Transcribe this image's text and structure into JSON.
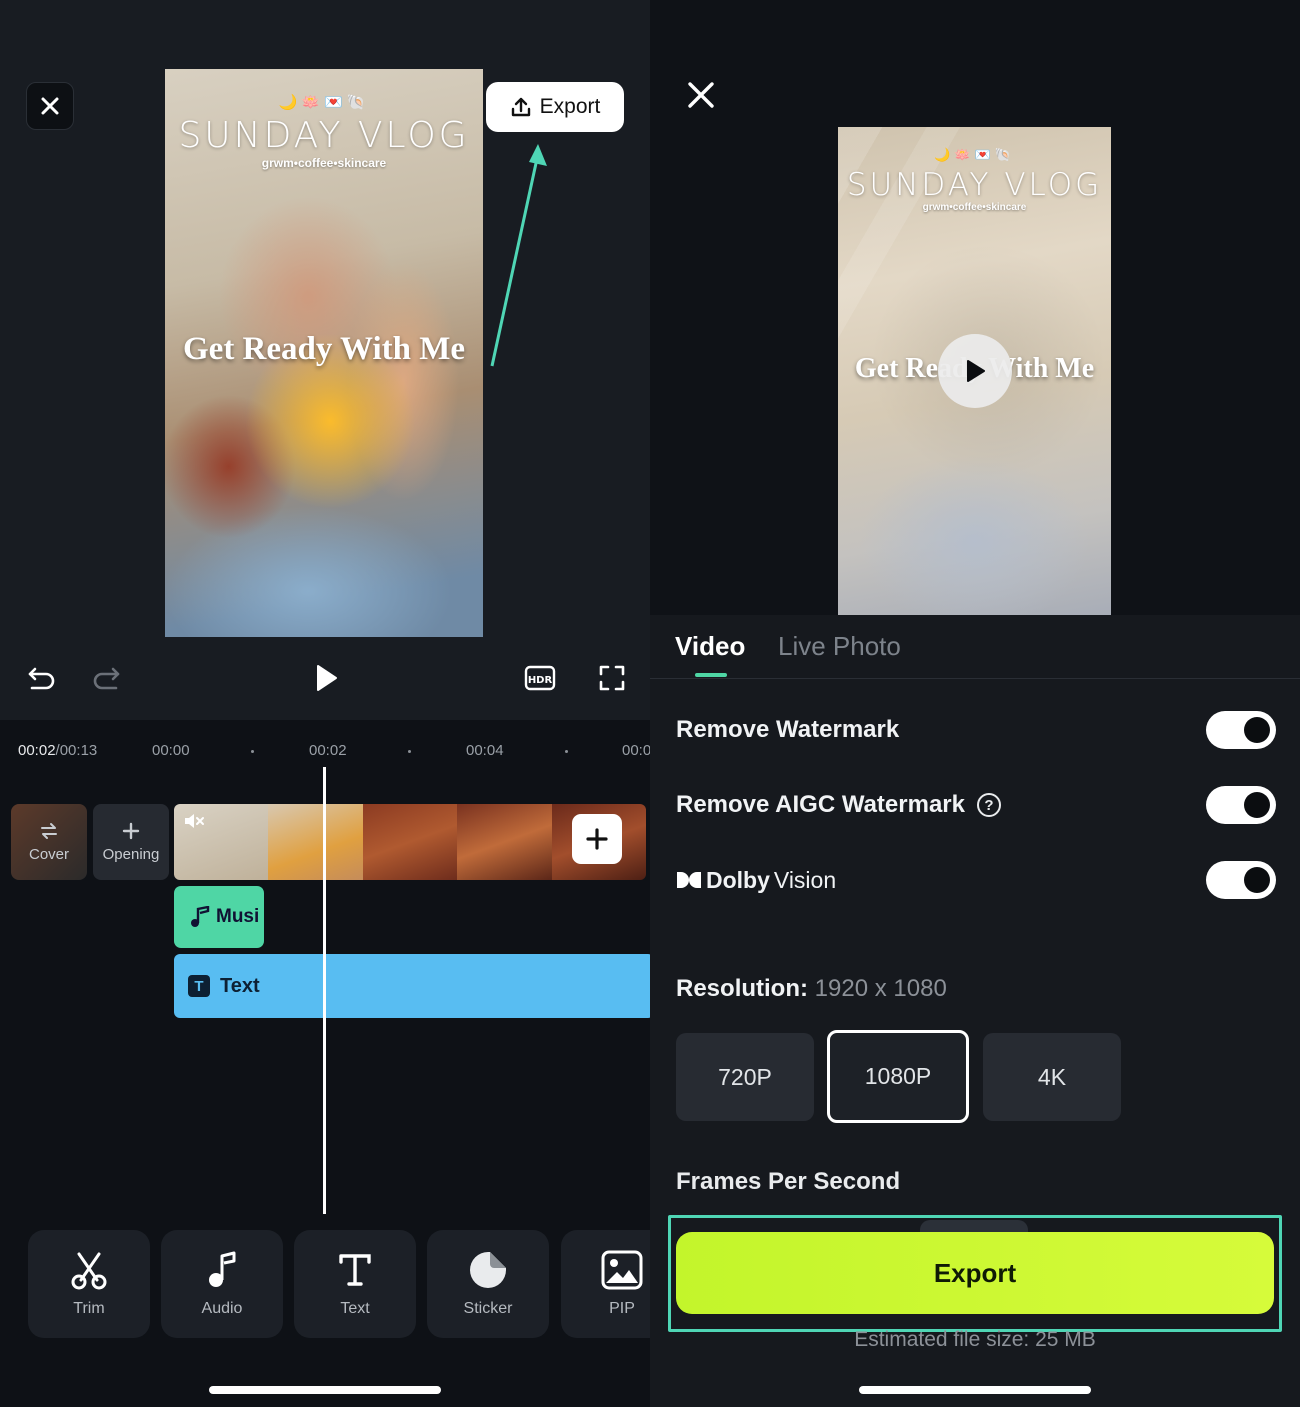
{
  "editor": {
    "export_label": "Export",
    "video": {
      "emojis": "🌙🪷💌🐚",
      "title": "SUNDAY VLOG",
      "subtitle": "grwm•coffee•skincare",
      "caption": "Get Ready With Me"
    },
    "timeline": {
      "current": "00:02",
      "total": "/00:13",
      "ticks": [
        "00:00",
        "00:02",
        "00:04",
        "00:0"
      ]
    },
    "cover_label": "Cover",
    "opening_label": "Opening",
    "music_label": "Musi",
    "text_track_label": "Text",
    "toolbar": [
      {
        "label": "Trim",
        "icon": "scissors-icon"
      },
      {
        "label": "Audio",
        "icon": "music-note-icon"
      },
      {
        "label": "Text",
        "icon": "text-icon"
      },
      {
        "label": "Sticker",
        "icon": "sticker-icon"
      },
      {
        "label": "PIP",
        "icon": "pip-icon"
      }
    ],
    "hdr_label": "HDR"
  },
  "export_panel": {
    "tabs": [
      "Video",
      "Live Photo"
    ],
    "active_tab": "Video",
    "options": {
      "remove_watermark": "Remove Watermark",
      "remove_aigc": "Remove AIGC Watermark",
      "dolby_brand": "Dolby",
      "dolby_vision": "Vision"
    },
    "toggles": {
      "remove_watermark": true,
      "remove_aigc": true,
      "dolby_vision": true
    },
    "resolution_label": "Resolution:",
    "resolution_value": "1920 x 1080",
    "resolutions": [
      "720P",
      "1080P",
      "4K"
    ],
    "selected_resolution": "1080P",
    "fps_label": "Frames Per Second",
    "export_button": "Export",
    "estimated_size": "Estimated file size: 25 MB"
  },
  "colors": {
    "accent": "#4fd6a5",
    "export_green": "#c8f72e",
    "text_track": "#58bdf2"
  }
}
